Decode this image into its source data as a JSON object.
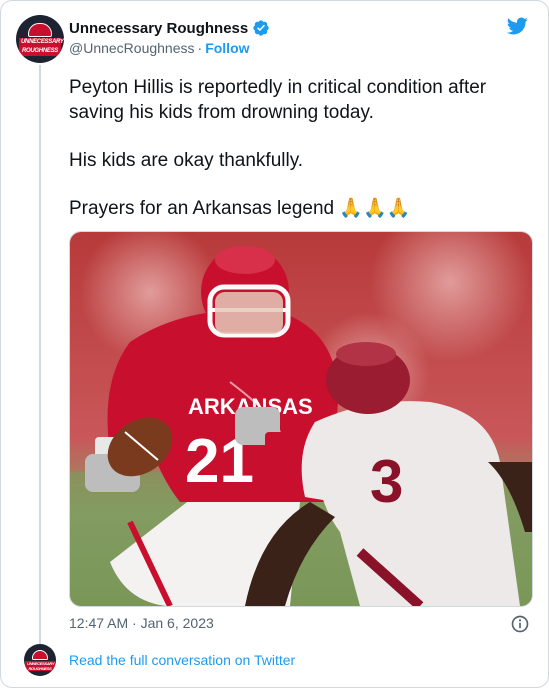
{
  "account": {
    "name": "Unnecessary Roughness",
    "handle": "@UnnecRoughness",
    "separator": "·",
    "follow_label": "Follow",
    "logo_text": "UNNECESSARY ROUGHNESS"
  },
  "tweet": {
    "paragraphs": [
      "Peyton Hillis is reportedly in critical condition after saving his kids from drowning today.",
      "His kids are okay thankfully.",
      "Prayers for an Arkansas legend 🙏🙏🙏"
    ],
    "timestamp": "12:47 AM · Jan 6, 2023"
  },
  "photo": {
    "jersey_text": "ARKANSAS",
    "home_number": "21",
    "away_number": "3"
  },
  "footer": {
    "read_link": "Read the full conversation on Twitter"
  },
  "colors": {
    "accent": "#1d9bf0",
    "text": "#0f1419",
    "muted": "#536471",
    "border": "#cfd9de"
  }
}
